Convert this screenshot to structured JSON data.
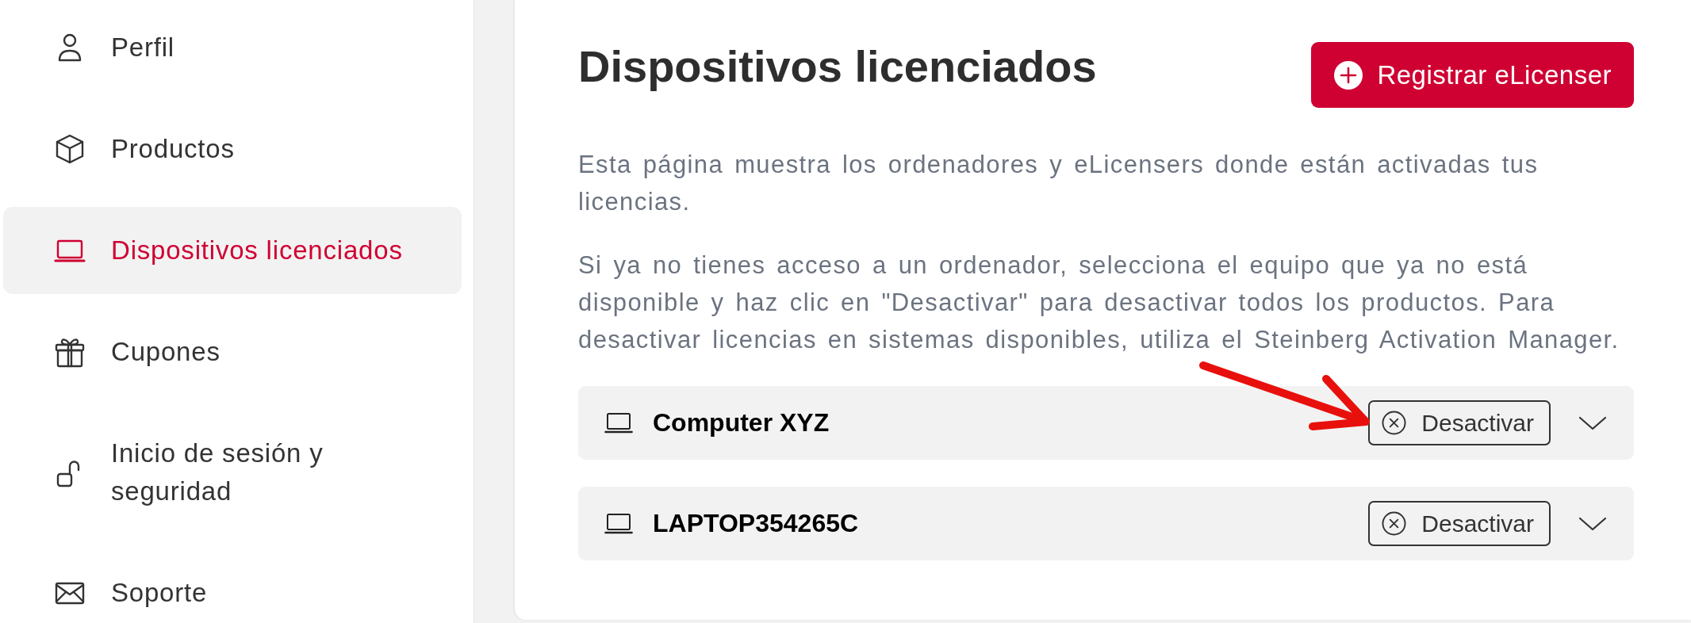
{
  "sidebar": {
    "items": [
      {
        "label": "Perfil",
        "selected": false
      },
      {
        "label": "Productos",
        "selected": false
      },
      {
        "label": "Dispositivos licenciados",
        "selected": true
      },
      {
        "label": "Cupones",
        "selected": false
      },
      {
        "label": "Inicio de sesión y seguridad",
        "selected": false
      },
      {
        "label": "Soporte",
        "selected": false
      }
    ]
  },
  "content": {
    "title": "Dispositivos licenciados",
    "register_button": "Registrar eLicenser",
    "paragraphs": [
      "Esta página muestra los ordenadores y eLicensers donde están activadas tus licencias.",
      "Si ya no tienes acceso a un ordenador, selecciona el equipo que ya no está disponible y haz clic en \"Desactivar\" para desactivar todos los productos. Para desactivar licencias en sistemas disponibles, utiliza el Steinberg Activation Manager."
    ],
    "devices": [
      {
        "name": "Computer XYZ",
        "action": "Desactivar",
        "expanded": false,
        "pointer_arrow": true
      },
      {
        "name": "LAPTOP354265C",
        "action": "Desactivar",
        "expanded": false,
        "pointer_arrow": false
      }
    ]
  }
}
